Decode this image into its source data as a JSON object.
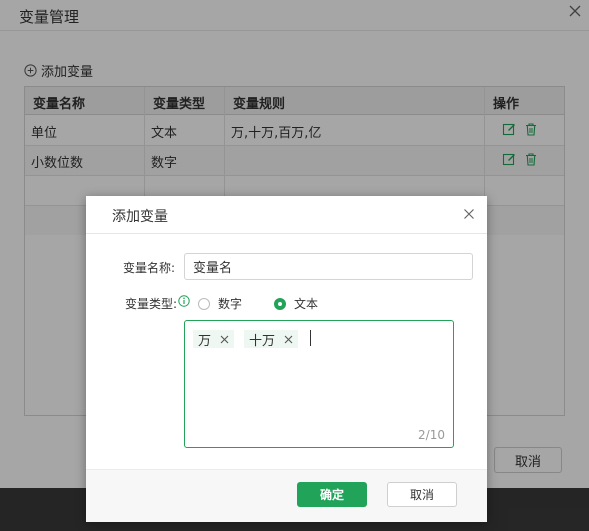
{
  "outer_dialog": {
    "title": "变量管理",
    "add_label": "添加变量",
    "cancel_label": "取消",
    "table": {
      "headers": [
        "变量名称",
        "变量类型",
        "变量规则",
        "操作"
      ],
      "rows": [
        {
          "name": "单位",
          "type": "文本",
          "rule": "万,十万,百万,亿"
        },
        {
          "name": "小数位数",
          "type": "数字",
          "rule": ""
        }
      ]
    }
  },
  "modal": {
    "title": "添加变量",
    "name_label": "变量名称:",
    "name_placeholder": "变量名",
    "type_label": "变量类型:",
    "type_options": [
      {
        "label": "数字",
        "selected": false
      },
      {
        "label": "文本",
        "selected": true
      }
    ],
    "tags": [
      "万",
      "十万"
    ],
    "tag_counter": "2/10",
    "ok_label": "确定",
    "cancel_label": "取消"
  },
  "colors": {
    "accent": "#22a35a",
    "tag_bg": "#eef7f1"
  }
}
